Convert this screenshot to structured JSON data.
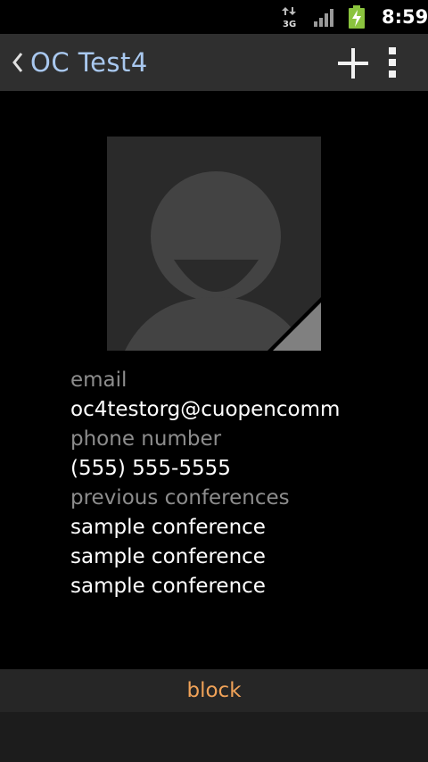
{
  "status_bar": {
    "network_icon": "data-3g-icon",
    "network_label": "3G",
    "signal_icon": "signal-strength-icon",
    "battery_icon": "battery-charging-icon",
    "time": "8:59"
  },
  "action_bar": {
    "back_icon": "chevron-left-icon",
    "title": "OC Test4",
    "add_icon": "plus-icon",
    "menu_icon": "overflow-menu-icon"
  },
  "avatar": {
    "icon": "default-contact-avatar-icon"
  },
  "contact": {
    "email_label": "email",
    "email_value": "oc4testorg@cuopencomm",
    "phone_label": "phone number",
    "phone_value": "(555) 555-5555",
    "conferences_label": "previous conferences",
    "conferences": [
      "sample conference",
      "sample conference",
      "sample conference"
    ]
  },
  "footer": {
    "block_label": "block"
  },
  "colors": {
    "title": "#a9c8ef",
    "label": "#8d8d8d",
    "accent": "#f0a258",
    "action_bar": "#2f2f2f"
  }
}
